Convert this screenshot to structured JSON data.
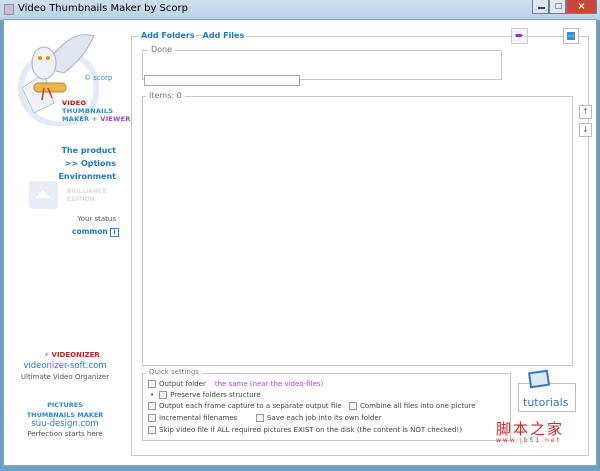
{
  "window": {
    "title": "Video Thumbnails Maker by Scorp"
  },
  "sidebar": {
    "brand": {
      "scorp": "© scorp",
      "line1": "VIDEO",
      "line2": "THUMBNAILS",
      "line3a": "MAKER + ",
      "line3b": "VIEWER"
    },
    "nav": [
      {
        "label": "The product"
      },
      {
        "label": ">> Options"
      },
      {
        "label": "Environment"
      }
    ],
    "edition": {
      "line1": "BRILLIANCE",
      "line2": "EDITION"
    },
    "status": {
      "label": "Your status",
      "value": "common",
      "info": "i"
    },
    "promo1": {
      "name": "VIDEONIZER",
      "url": "videonizer-soft.com",
      "tagline": "Ultimate Video Organizer"
    },
    "promo2": {
      "name1": "PICTURES",
      "name2": "THUMBNAILS MAKER",
      "url": "suu-design.com",
      "tagline": "Perfection starts here"
    }
  },
  "main": {
    "add_folders": "Add Folders",
    "add_files": "Add Files",
    "done_label": "Done",
    "progress": 0,
    "items_label": "Items: 0",
    "up": "↑",
    "down": "↓"
  },
  "quick": {
    "title": "Quick settings",
    "output_folder": "Output folder",
    "output_folder_value": "the same (near the video-files)",
    "preserve": "Preserve folders structure",
    "separate": "Output each frame capture to a separate output file",
    "combine": "Combine all files into one picture",
    "incremental": "Incremental filenames",
    "ownfolder": "Save each job into its own folder",
    "skip": "Skip video file if ALL required pictures EXIST on the disk (the content is NOT checked!)",
    "tutorials": "tutorials"
  },
  "watermark": {
    "text": "脚本之家",
    "url": "www.jb51.net"
  }
}
